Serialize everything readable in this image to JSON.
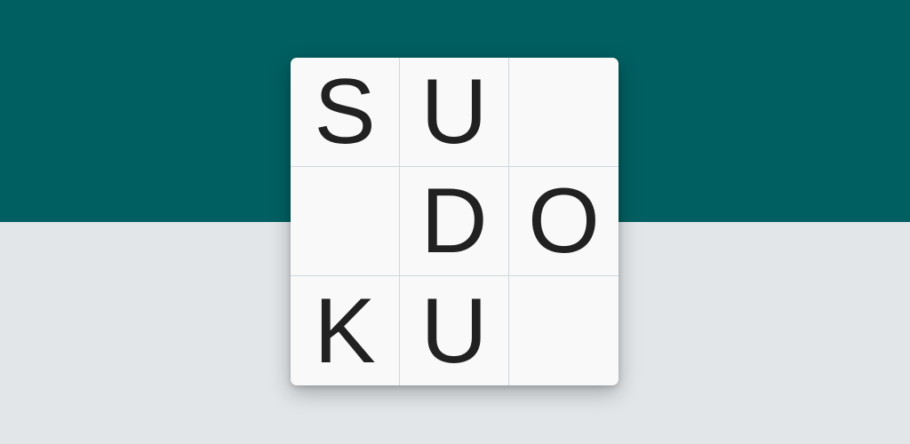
{
  "board": {
    "cells": [
      "S",
      "U",
      "",
      "",
      "D",
      "O",
      "K",
      "U",
      ""
    ]
  }
}
